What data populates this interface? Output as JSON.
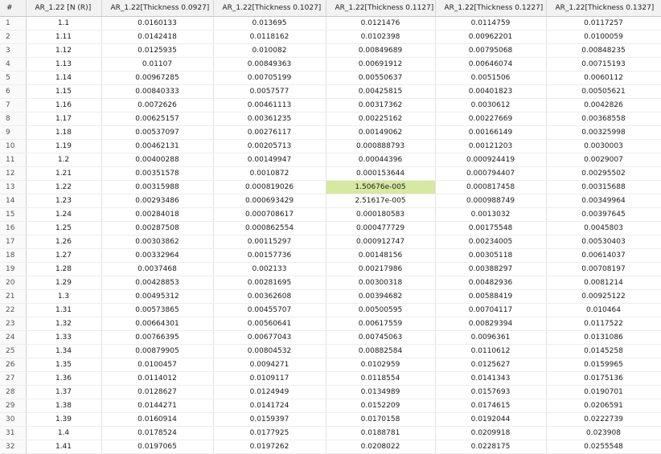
{
  "table": {
    "headers": [
      "#",
      "AR_1.22 [N (R)]",
      "AR_1.22[Thickness 0.0927]",
      "AR_1.22[Thickness 0.1027]",
      "AR_1.22[Thickness 0.1127]",
      "AR_1.22[Thickness 0.1227]",
      "AR_1.22[Thickness 0.1327]"
    ],
    "highlight_color": "#d6e9a0",
    "selected_cell": {
      "row": 12,
      "col": 4
    },
    "rows": [
      [
        "1",
        "1.1",
        "0.0160133",
        "0.013695",
        "0.0121476",
        "0.0114759",
        "0.0117257"
      ],
      [
        "2",
        "1.11",
        "0.0142418",
        "0.0118162",
        "0.0102398",
        "0.00962201",
        "0.0100059"
      ],
      [
        "3",
        "1.12",
        "0.0125935",
        "0.010082",
        "0.00849689",
        "0.00795068",
        "0.00848235"
      ],
      [
        "4",
        "1.13",
        "0.01107",
        "0.00849363",
        "0.00691912",
        "0.00646074",
        "0.00715193"
      ],
      [
        "5",
        "1.14",
        "0.00967285",
        "0.00705199",
        "0.00550637",
        "0.0051506",
        "0.0060112"
      ],
      [
        "6",
        "1.15",
        "0.00840333",
        "0.0057577",
        "0.00425815",
        "0.00401823",
        "0.00505621"
      ],
      [
        "7",
        "1.16",
        "0.0072626",
        "0.00461113",
        "0.00317362",
        "0.0030612",
        "0.0042826"
      ],
      [
        "8",
        "1.17",
        "0.00625157",
        "0.00361235",
        "0.00225162",
        "0.00227669",
        "0.00368558"
      ],
      [
        "9",
        "1.18",
        "0.00537097",
        "0.00276117",
        "0.00149062",
        "0.00166149",
        "0.00325998"
      ],
      [
        "10",
        "1.19",
        "0.00462131",
        "0.00205713",
        "0.000888793",
        "0.00121203",
        "0.0030003"
      ],
      [
        "11",
        "1.2",
        "0.00400288",
        "0.00149947",
        "0.00044396",
        "0.000924419",
        "0.0029007"
      ],
      [
        "12",
        "1.21",
        "0.00351578",
        "0.0010872",
        "0.000153644",
        "0.000794407",
        "0.00295502"
      ],
      [
        "13",
        "1.22",
        "0.00315988",
        "0.000819026",
        "1.50676e-005",
        "0.000817458",
        "0.00315688"
      ],
      [
        "14",
        "1.23",
        "0.00293486",
        "0.000693429",
        "2.51617e-005",
        "0.000988749",
        "0.00349964"
      ],
      [
        "15",
        "1.24",
        "0.00284018",
        "0.000708617",
        "0.000180583",
        "0.0013032",
        "0.00397645"
      ],
      [
        "16",
        "1.25",
        "0.00287508",
        "0.000862554",
        "0.000477729",
        "0.00175548",
        "0.0045803"
      ],
      [
        "17",
        "1.26",
        "0.00303862",
        "0.00115297",
        "0.000912747",
        "0.00234005",
        "0.00530403"
      ],
      [
        "18",
        "1.27",
        "0.00332964",
        "0.00157736",
        "0.00148156",
        "0.00305118",
        "0.00614037"
      ],
      [
        "19",
        "1.28",
        "0.0037468",
        "0.002133",
        "0.00217986",
        "0.00388297",
        "0.00708197"
      ],
      [
        "20",
        "1.29",
        "0.00428853",
        "0.00281695",
        "0.00300318",
        "0.00482936",
        "0.0081214"
      ],
      [
        "21",
        "1.3",
        "0.00495312",
        "0.00362608",
        "0.00394682",
        "0.00588419",
        "0.00925122"
      ],
      [
        "22",
        "1.31",
        "0.00573865",
        "0.00455707",
        "0.00500595",
        "0.00704117",
        "0.010464"
      ],
      [
        "23",
        "1.32",
        "0.00664301",
        "0.00560641",
        "0.00617559",
        "0.00829394",
        "0.0117522"
      ],
      [
        "24",
        "1.33",
        "0.00766395",
        "0.00677043",
        "0.00745063",
        "0.0096361",
        "0.0131086"
      ],
      [
        "25",
        "1.34",
        "0.00879905",
        "0.00804532",
        "0.00882584",
        "0.0110612",
        "0.0145258"
      ],
      [
        "26",
        "1.35",
        "0.0100457",
        "0.0094271",
        "0.0102959",
        "0.0125627",
        "0.0159965"
      ],
      [
        "27",
        "1.36",
        "0.0114012",
        "0.0109117",
        "0.0118554",
        "0.0141343",
        "0.0175136"
      ],
      [
        "28",
        "1.37",
        "0.0128627",
        "0.0124949",
        "0.0134989",
        "0.0157693",
        "0.0190701"
      ],
      [
        "29",
        "1.38",
        "0.0144271",
        "0.0141724",
        "0.0152209",
        "0.0174615",
        "0.0206591"
      ],
      [
        "30",
        "1.39",
        "0.0160914",
        "0.0159397",
        "0.0170158",
        "0.0192044",
        "0.0222739"
      ],
      [
        "31",
        "1.4",
        "0.0178524",
        "0.0177925",
        "0.0188781",
        "0.0209918",
        "0.023908"
      ],
      [
        "32",
        "1.41",
        "0.0197065",
        "0.0197262",
        "0.0208022",
        "0.0228175",
        "0.0255548"
      ]
    ]
  }
}
